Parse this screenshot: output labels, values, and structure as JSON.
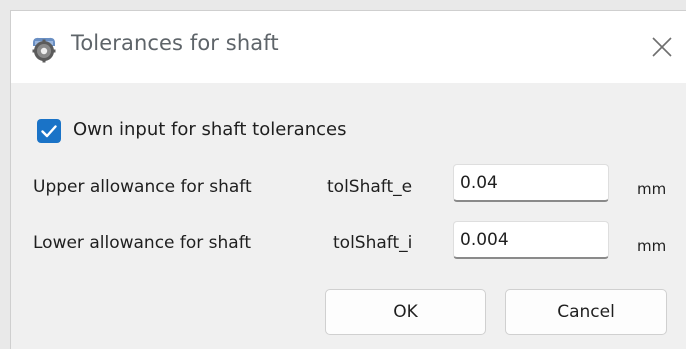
{
  "window": {
    "title": "Tolerances for shaft",
    "app_icon": "gear-app-icon",
    "close_icon": "close-icon"
  },
  "checkbox": {
    "label": "Own input for shaft tolerances",
    "checked": true,
    "color": "#1a73c7"
  },
  "rows": [
    {
      "label": "Upper allowance for shaft",
      "variable": "tolShaft_e",
      "value": "0.04",
      "unit": "mm"
    },
    {
      "label": "Lower allowance for shaft",
      "variable": "tolShaft_i",
      "value": "0.004",
      "unit": "mm"
    }
  ],
  "buttons": {
    "ok": "OK",
    "cancel": "Cancel"
  }
}
